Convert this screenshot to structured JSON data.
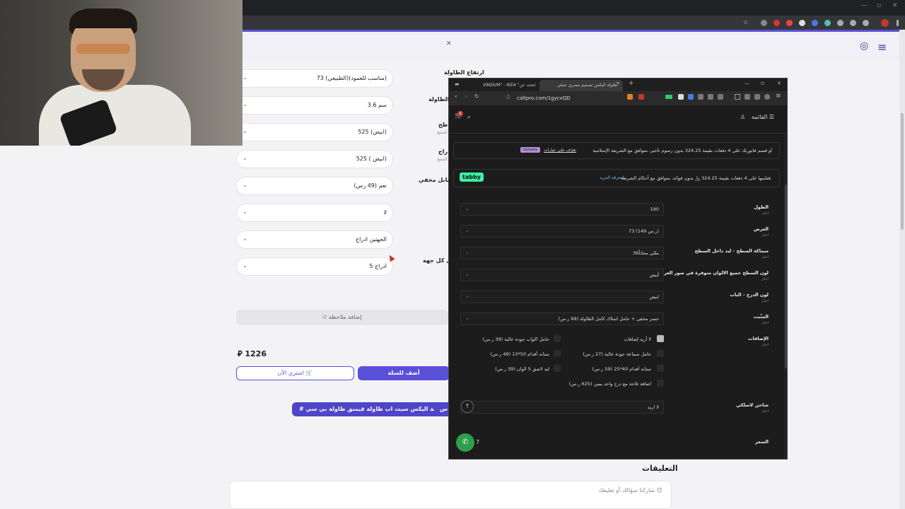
{
  "site": {
    "form": [
      {
        "label": "ارتفاع الطاولة",
        "value": "73 (الطبيعي)(مناسب للعمود)"
      },
      {
        "label": "الطاولة",
        "value": "3.6 سم"
      },
      {
        "label": "طح",
        "sublabel": "في صور المنتج",
        "value": "525 (ابيض)"
      },
      {
        "label": "راج",
        "sublabel": "في صور المنتج",
        "value": "525 ( ابيض)"
      },
      {
        "label": "كيابل مخفي",
        "value": "نعم (49 رس)"
      },
      {
        "label": "",
        "value": "لا"
      },
      {
        "label": "",
        "value": "الجهتين ادراج"
      },
      {
        "label": "ي كل جهة",
        "value": "5 ادراج"
      }
    ],
    "add_note": "إضافة ملاحظة",
    "price": "1226",
    "currency_icon": "riyal-icon",
    "buy_now": "اشتري الآن",
    "add_to_cart": "أضف للسلة",
    "tags": [
      "# طاولة اليكس سيت اب طاولة قيمنق طاولة بي سي",
      "س"
    ],
    "comments_title": "التعليقات",
    "comment_placeholder": "شاركنا سؤالك أو تعليقك"
  },
  "window": {
    "tabs": [
      "VINDUM\" - IKEA \"ابحث عن",
      "طاولة اليكس تصميم مصري عملي"
    ],
    "url": "caltpro.com/1gycvQD",
    "header": {
      "menu": "القائمة",
      "cart_count": "0"
    },
    "tamara_text": "أو قسم فاتورتك على 4 دفعات بقيمة 324.25 بدون رسوم تأخير، متوافق مع الشريعة الإسلامية",
    "tamara_link": "تعرّف على عيارات",
    "tamara_brand": "tamara",
    "tabby_text": "قسّمها على 4 دفعات بقيمة 324.25 ﷼ بدون فوائد، متوافق مع أحكام الشريعة.",
    "tabby_link": "لمعرفة المزيد",
    "tabby_brand": "tabby",
    "fields": [
      {
        "label": "الطول",
        "sub": "اختار",
        "value": "190"
      },
      {
        "label": "العرض",
        "sub": "اختار",
        "value": "73 (149 ر.س)"
      },
      {
        "label": "سماكة السطح - ليد داخل السطح",
        "sub": "اختار",
        "value": "36مللي مجاناً"
      },
      {
        "label": "لون السطح جميع الالوان متوفرة في صور العرض",
        "sub": "اختار",
        "value": "أبيض"
      },
      {
        "label": "لون الدرج - الباب",
        "sub": "اختار",
        "value": "ابيض"
      },
      {
        "label": "المثّبت",
        "sub": "اختار",
        "value": "جسر مخفي + حامل اسلاك كامل الطاولة (99 ر.س)"
      }
    ],
    "addons_label": "الإضافات",
    "addons_sub": "اختار",
    "addons": [
      {
        "text": "لا أريد إضافات",
        "checked": true
      },
      {
        "text": "حامل اكواب جودة عالية (39 ر.س)",
        "checked": false
      },
      {
        "text": "حامل سماعة جودة عالية (27 ر.س)",
        "checked": false
      },
      {
        "text": "ستاند أقدام 50*13 (49 ر.س)",
        "checked": false
      },
      {
        "text": "ستاند أقدام 40*25 (59 ر.س)",
        "checked": false
      },
      {
        "text": "ليد لاصق 5 الوان (39 ر.س)",
        "checked": false
      },
      {
        "text": "اضافة ثلاجة مع درج واحد يمين (625 ر.س)",
        "checked": false
      }
    ],
    "charger_label": "شاحن لاسلكي",
    "charger_sub": "اختار",
    "charger_value": "لا اريد",
    "price_label": "السعر",
    "price_partial": "7"
  }
}
